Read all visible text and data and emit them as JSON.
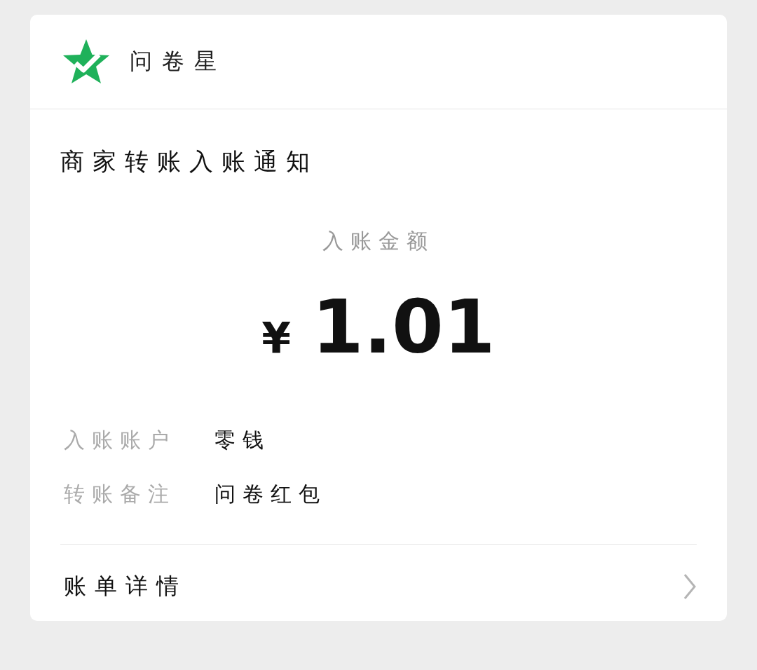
{
  "header": {
    "brand": "问卷星"
  },
  "notice": {
    "title": "商家转账入账通知",
    "amount_label": "入账金额",
    "currency": "¥",
    "amount": "1.01"
  },
  "details": [
    {
      "label": "入账账户",
      "value": "零钱"
    },
    {
      "label": "转账备注",
      "value": "问卷红包"
    }
  ],
  "footer_link": {
    "label": "账单详情"
  }
}
